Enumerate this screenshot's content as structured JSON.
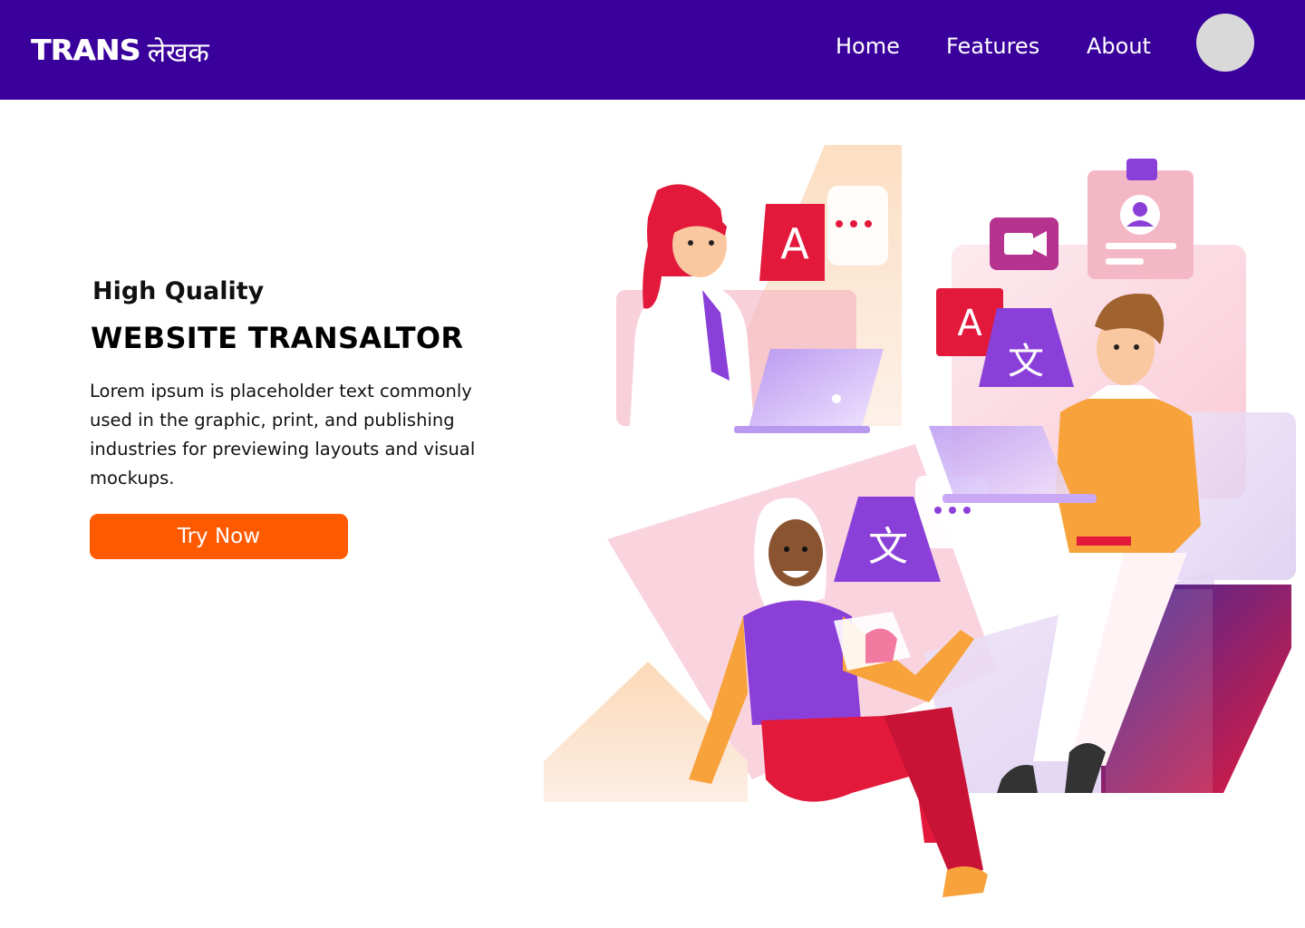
{
  "header": {
    "brand": {
      "latin": "TRANS",
      "devanagari": "लेखक"
    },
    "nav": [
      {
        "label": "Home"
      },
      {
        "label": "Features"
      },
      {
        "label": "About"
      }
    ]
  },
  "hero": {
    "subtitle": "High Quality",
    "title": "WEBSITE TRANSALTOR",
    "description": "Lorem ipsum is placeholder text commonly used in the graphic, print, and publishing industries for previewing layouts and visual mockups.",
    "cta_label": "Try Now"
  },
  "illustration": {
    "glyph_latin": "A",
    "glyph_cjk": "文"
  },
  "colors": {
    "navbar": "#3a009c",
    "cta": "#ff5a00",
    "avatar": "#d9d9d9",
    "accent_red": "#e3193b",
    "accent_purple": "#8b3fd9",
    "accent_orange": "#f7a23a"
  }
}
